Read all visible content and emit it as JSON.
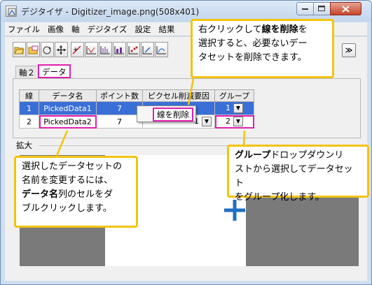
{
  "window": {
    "title": "デジタイザ - Digitizer_image.png(508x401)"
  },
  "menu": [
    "ファイル",
    "画像",
    "軸",
    "デジタイズ",
    "設定",
    "結果"
  ],
  "toolbar": {
    "collapse_symbol": "≫"
  },
  "tabs": {
    "axis2": "軸２",
    "data": "データ"
  },
  "grid": {
    "columns": [
      "線",
      "データ名",
      "ポイント数",
      "ピクセル削減要因",
      "グループ"
    ],
    "rows": [
      {
        "line": "1",
        "name": "PickedData1",
        "points": "7",
        "reduce": "",
        "group": "1"
      },
      {
        "line": "2",
        "name": "PickedData2",
        "points": "7",
        "reduce": "1",
        "group": "2"
      }
    ]
  },
  "context_menu": {
    "item": "線を削除"
  },
  "zoom": {
    "label": "拡大"
  },
  "callouts": {
    "right_click": {
      "line1_pre": "右クリックして",
      "line1_bold": "線を削除",
      "line1_post": "を",
      "line2": "選択すると、必要ないデー",
      "line3": "タセットを削除できます。"
    },
    "rename": {
      "line1": "選択したデータセットの",
      "line2": "名前を変更するには、",
      "line3_bold": "データ名",
      "line3_post": "列のセルをダ",
      "line4": "ブルクリックします。"
    },
    "group": {
      "line1_bold": "グループ",
      "line1_post": "ドロップダウンリ",
      "line2": "ストから選択してデータセット",
      "line3": "をグループ化します。"
    }
  },
  "colors": {
    "highlight": "#e020b0",
    "callout_border": "#f2c410",
    "selection": "#3a6fd8",
    "crosshair": "#1e6fc0"
  }
}
